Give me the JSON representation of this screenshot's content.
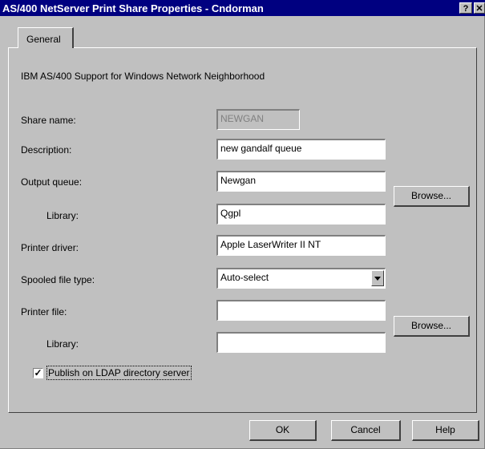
{
  "window": {
    "title": "AS/400 NetServer Print Share Properties - Cndorman",
    "help_label": "?",
    "close_label": "✕"
  },
  "tabs": [
    {
      "label": "General"
    }
  ],
  "description_text": "IBM AS/400 Support for Windows Network Neighborhood",
  "form": {
    "share_name": {
      "label": "Share name:",
      "value": "NEWGAN"
    },
    "description": {
      "label": "Description:",
      "value": "new gandalf queue"
    },
    "output_queue": {
      "label": "Output queue:",
      "value": "Newgan"
    },
    "output_library": {
      "label": "Library:",
      "value": "Qgpl"
    },
    "printer_driver": {
      "label": "Printer driver:",
      "value": "Apple LaserWriter II NT"
    },
    "spooled_file_type": {
      "label": "Spooled file type:",
      "value": "Auto-select"
    },
    "printer_file": {
      "label": "Printer file:",
      "value": ""
    },
    "printer_library": {
      "label": "Library:",
      "value": ""
    },
    "browse_label": "Browse...",
    "publish": {
      "label": "Publish on LDAP directory server",
      "checked": true,
      "mark": "✓"
    }
  },
  "buttons": {
    "ok": "OK",
    "cancel": "Cancel",
    "help": "Help"
  }
}
